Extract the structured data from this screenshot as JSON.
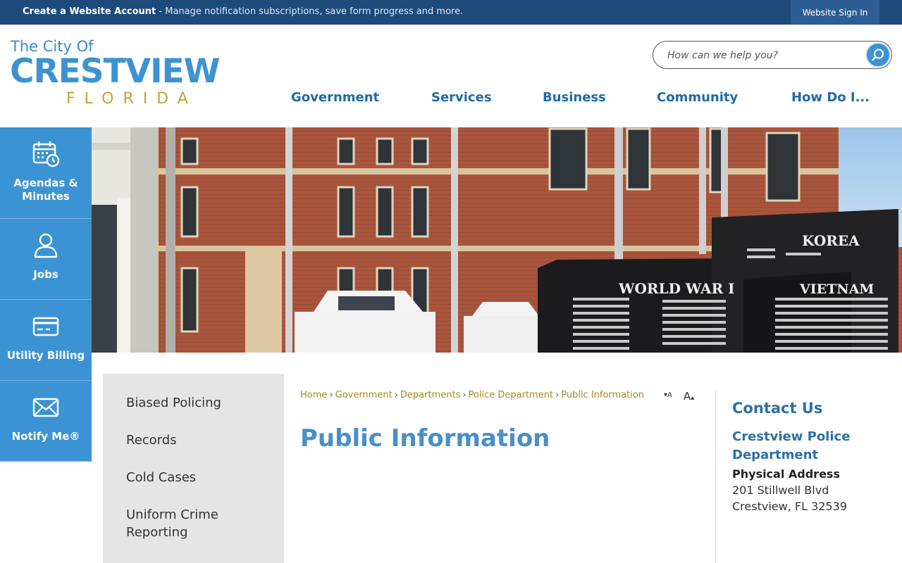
{
  "topbar": {
    "create_account": "Create a Website Account",
    "message": " - Manage notification subscriptions, save form progress and more.",
    "signin_label": "Website Sign In"
  },
  "logo": {
    "line1": "The City Of",
    "line2": "CRESTVIEW",
    "line3": "FLORIDA"
  },
  "search": {
    "placeholder": "How can we help you?",
    "value": ""
  },
  "nav": {
    "items": [
      "Government",
      "Services",
      "Business",
      "Community",
      "How Do I..."
    ]
  },
  "hero": {
    "monument_1": "WORLD WAR I",
    "monument_2": "VIETNAM",
    "monument_3": "KOREA"
  },
  "quick_links": [
    {
      "label": "Agendas & Minutes",
      "icon": "calendar-clock-icon"
    },
    {
      "label": "Jobs",
      "icon": "person-icon"
    },
    {
      "label": "Utility Billing",
      "icon": "credit-card-icon"
    },
    {
      "label": "Notify Me®",
      "icon": "envelope-icon"
    }
  ],
  "sidenav": {
    "links": [
      "Biased Policing",
      "Records",
      "Cold Cases",
      "Uniform Crime Reporting"
    ]
  },
  "breadcrumb": {
    "items": [
      "Home",
      "Government",
      "Departments",
      "Police Department"
    ],
    "current": "Public Information",
    "separator": "›"
  },
  "font_resize": {
    "decrease": "A",
    "increase": "A"
  },
  "page": {
    "title": "Public Information"
  },
  "contact": {
    "heading": "Contact Us",
    "department": "Crestview Police Department",
    "address_label": "Physical Address",
    "address_line1": "201 Stillwell Blvd",
    "address_line2": "Crestview, FL 32539"
  },
  "colors": {
    "topbar": "#1d4a7a",
    "accent_blue": "#3b93d3",
    "nav_text": "#1f6aa3",
    "breadcrumb_gold": "#a9891f",
    "title_blue": "#4a8fc8",
    "sidenav_bg": "#e5e5e5"
  }
}
